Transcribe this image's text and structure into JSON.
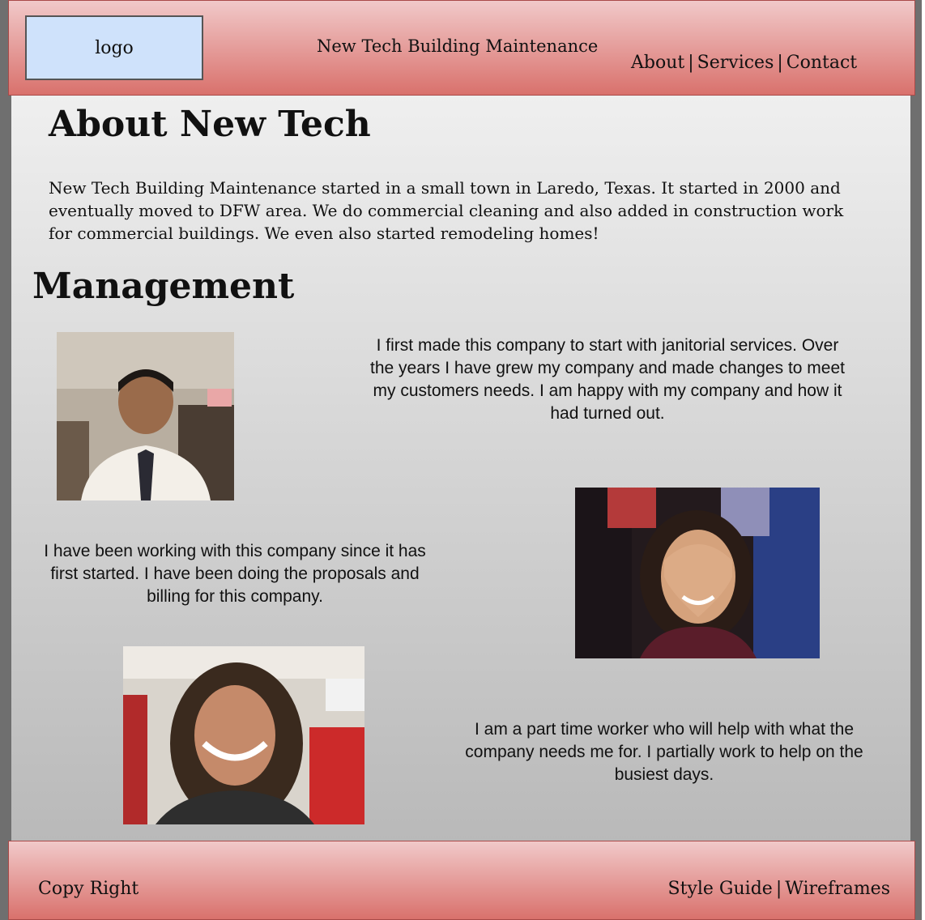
{
  "header": {
    "logo_text": "logo",
    "site_title": "New Tech Building Maintenance",
    "nav": [
      "About",
      "Services",
      "Contact"
    ],
    "separator": "|"
  },
  "about": {
    "heading": "About New Tech",
    "text": "New Tech Building Maintenance started in a small town in Laredo, Texas. It started in 2000 and eventually moved to DFW area. We do commercial cleaning and also added in construction work for commercial buildings. We even also started remodeling homes!"
  },
  "management": {
    "heading": "Management",
    "bios": [
      "I first made this company to start with janitorial services. Over the years I have grew my company and made changes to meet my customers needs. I am happy with my company and how it had turned out.",
      "I have been working with this company since it has first started. I have been doing the proposals and billing for this company.",
      "I am a part time worker who will help with what the company needs me for. I partially work to help on the busiest days."
    ]
  },
  "footer": {
    "copyright": "Copy Right",
    "links": [
      "Style Guide",
      "Wireframes"
    ],
    "separator": "|"
  },
  "colors": {
    "header_gradient_top": "#f1c9c9",
    "header_gradient_bottom": "#d9716c",
    "logo_bg": "#cfe2fb",
    "content_gradient_top": "#efefef",
    "content_gradient_bottom": "#b9b9b9"
  }
}
